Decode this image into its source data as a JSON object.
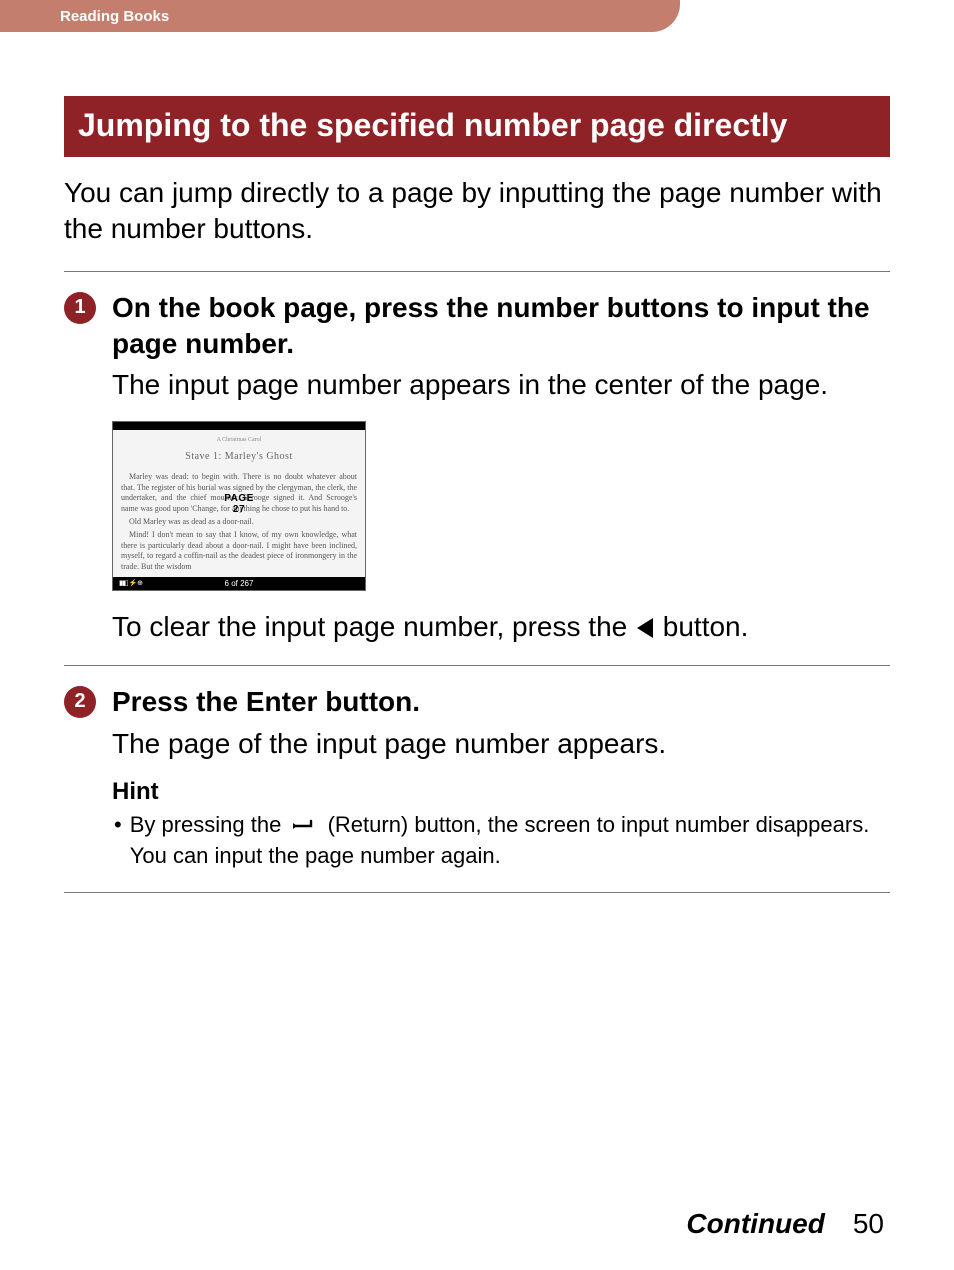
{
  "header": {
    "tab": "Reading Books"
  },
  "title": "Jumping to the specified number page directly",
  "intro": "You can jump directly to a page by inputting the page number with the number buttons.",
  "steps": [
    {
      "num": "1",
      "title": "On the book page, press the number buttons to input the page number.",
      "text": "The input page number appears in the center of the page."
    },
    {
      "num": "2",
      "title": "Press the Enter button.",
      "text": "The page of the input page number appears."
    }
  ],
  "screenshot": {
    "top_label": "A Christmas Carol",
    "chapter_title": "Stave 1: Marley's Ghost",
    "para1": "Marley was dead: to begin with. There is no doubt whatever about that. The register of his burial was signed by the clergyman, the clerk, the undertaker, and the chief mourner. Scrooge signed it. And Scrooge's name was good upon 'Change, for anything he chose to put his hand to.",
    "para_mid": "Old Marley was as dead as a door-nail.",
    "para2": "Mind! I don't mean to say that I know, of my own knowledge, what there is particularly dead about a door-nail. I might have been inclined, myself, to regard a coffin-nail as the deadest piece of ironmongery in the trade. But the wisdom",
    "overlay_label": "PAGE",
    "overlay_num": "27",
    "footer_page": "6 of 267"
  },
  "clear_text_before": "To clear the input page number, press the ",
  "clear_text_after": " button.",
  "hint": {
    "label": "Hint",
    "text_before": "By pressing the ",
    "text_after": " (Return) button, the screen to input number disappears. You can input the page number again."
  },
  "footer": {
    "continued": "Continued",
    "page": "50"
  }
}
